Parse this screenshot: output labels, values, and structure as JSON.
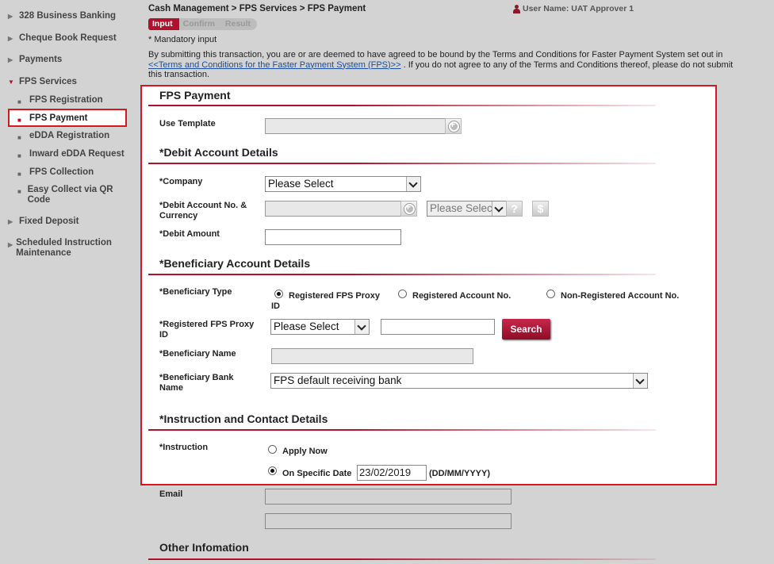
{
  "sidebar": {
    "items": [
      {
        "label": "328 Business Banking"
      },
      {
        "label": "Cheque Book Request"
      },
      {
        "label": "Payments"
      },
      {
        "label": "FPS Services"
      },
      {
        "label": "Fixed Deposit"
      },
      {
        "label": "Scheduled Instruction Maintenance"
      }
    ],
    "fps_sub": [
      {
        "label": "FPS Registration"
      },
      {
        "label": "FPS Payment"
      },
      {
        "label": "eDDA Registration"
      },
      {
        "label": "Inward eDDA Request"
      },
      {
        "label": "FPS Collection"
      },
      {
        "label": "Easy Collect via QR Code"
      }
    ]
  },
  "header": {
    "breadcrumb": "Cash Management > FPS Services > FPS Payment",
    "username": "User Name: UAT Approver 1",
    "steps": [
      "Input",
      "Confirm",
      "Result"
    ],
    "mandatory": "* Mandatory input",
    "terms_before": "By submitting this transaction, you are or are deemed to have agreed to be bound by the Terms and Conditions for Faster Payment System set out in ",
    "terms_link": "<<Terms and Conditions for the Faster Payment System (FPS)>>",
    "terms_after": " . If you do not agree to any of the Terms and Conditions thereof, please do not submit this transaction."
  },
  "form": {
    "fps_payment_title": "FPS Payment",
    "use_template_label": "Use Template",
    "debit_title": "*Debit Account Details",
    "company_label": "*Company",
    "company_value": "Please Select",
    "debit_account_label": "*Debit Account No. & Currency",
    "currency_value": "Please Select",
    "debit_amount_label": "*Debit Amount",
    "beneficiary_title": "*Beneficiary Account Details",
    "beneficiary_type_label": "*Beneficiary Type",
    "beneficiary_type_options": [
      "Registered FPS Proxy ID",
      "Registered Account No.",
      "Non-Registered Account No."
    ],
    "proxy_id_label": "*Registered FPS Proxy ID",
    "proxy_id_select": "Please Select",
    "search_label": "Search",
    "beneficiary_name_label": "*Beneficiary Name",
    "beneficiary_bank_label": "*Beneficiary Bank Name",
    "beneficiary_bank_value": "FPS default receiving bank",
    "instruction_title": "*Instruction and Contact Details",
    "instruction_label": "*Instruction",
    "apply_now_label": "Apply Now",
    "specific_date_label": "On Specific Date",
    "date_value": "23/02/2019",
    "date_format": "(DD/MM/YYYY)",
    "email_label": "Email",
    "other_title": "Other Infomation"
  }
}
